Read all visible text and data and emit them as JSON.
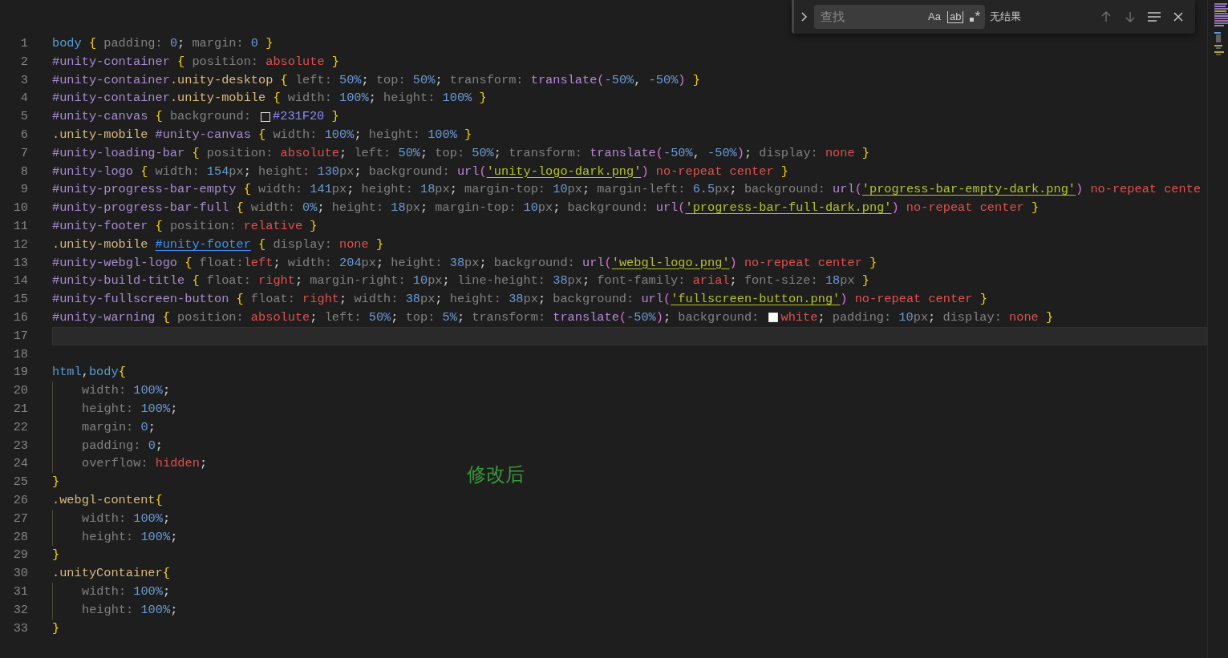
{
  "find_widget": {
    "placeholder": "查找",
    "options": [
      {
        "kind": "case",
        "label": "Aa"
      },
      {
        "kind": "word",
        "label": "ab"
      },
      {
        "kind": "regex",
        "label": "*"
      }
    ],
    "result": "无结果"
  },
  "lines": [
    {
      "number": "1",
      "tokens": [
        {
          "kind": "tag",
          "text": "body"
        },
        {
          "kind": "brace",
          "text": " {"
        },
        {
          "kind": "prop",
          "text": " padding: "
        },
        {
          "kind": "num",
          "text": "0"
        },
        {
          "kind": "p",
          "text": "; "
        },
        {
          "kind": "prop",
          "text": "margin: "
        },
        {
          "kind": "num",
          "text": "0"
        },
        {
          "kind": "brace",
          "text": " }"
        }
      ]
    },
    {
      "number": "2",
      "tokens": [
        {
          "kind": "id",
          "text": "#unity-container"
        },
        {
          "kind": "brace",
          "text": " {"
        },
        {
          "kind": "prop",
          "text": " position: "
        },
        {
          "kind": "val",
          "text": "absolute"
        },
        {
          "kind": "brace",
          "text": " }"
        }
      ]
    },
    {
      "number": "3",
      "tokens": [
        {
          "kind": "id",
          "text": "#unity-container"
        },
        {
          "kind": "cls",
          "text": ".unity-desktop"
        },
        {
          "kind": "brace",
          "text": " {"
        },
        {
          "kind": "prop",
          "text": " left: "
        },
        {
          "kind": "num",
          "text": "50%"
        },
        {
          "kind": "p",
          "text": "; "
        },
        {
          "kind": "prop",
          "text": "top: "
        },
        {
          "kind": "num",
          "text": "50%"
        },
        {
          "kind": "p",
          "text": "; "
        },
        {
          "kind": "prop",
          "text": "transform: "
        },
        {
          "kind": "fn",
          "text": "translate"
        },
        {
          "kind": "paren",
          "text": "("
        },
        {
          "kind": "num",
          "text": "-50%"
        },
        {
          "kind": "p",
          "text": ", "
        },
        {
          "kind": "num",
          "text": "-50%"
        },
        {
          "kind": "paren",
          "text": ")"
        },
        {
          "kind": "brace",
          "text": " }"
        }
      ]
    },
    {
      "number": "4",
      "tokens": [
        {
          "kind": "id",
          "text": "#unity-container"
        },
        {
          "kind": "cls",
          "text": ".unity-mobile"
        },
        {
          "kind": "brace",
          "text": " {"
        },
        {
          "kind": "prop",
          "text": " width: "
        },
        {
          "kind": "num",
          "text": "100%"
        },
        {
          "kind": "p",
          "text": "; "
        },
        {
          "kind": "prop",
          "text": "height: "
        },
        {
          "kind": "num",
          "text": "100%"
        },
        {
          "kind": "brace",
          "text": " }"
        }
      ]
    },
    {
      "number": "5",
      "tokens": [
        {
          "kind": "id",
          "text": "#unity-canvas"
        },
        {
          "kind": "brace",
          "text": " {"
        },
        {
          "kind": "prop",
          "text": " background: "
        },
        {
          "kind": "swatch",
          "color": "#231f20"
        },
        {
          "kind": "hex",
          "text": "#231F20"
        },
        {
          "kind": "brace",
          "text": " }"
        }
      ]
    },
    {
      "number": "6",
      "tokens": [
        {
          "kind": "cls",
          "text": ".unity-mobile "
        },
        {
          "kind": "id",
          "text": "#unity-canvas"
        },
        {
          "kind": "brace",
          "text": " {"
        },
        {
          "kind": "prop",
          "text": " width: "
        },
        {
          "kind": "num",
          "text": "100%"
        },
        {
          "kind": "p",
          "text": "; "
        },
        {
          "kind": "prop",
          "text": "height: "
        },
        {
          "kind": "num",
          "text": "100%"
        },
        {
          "kind": "brace",
          "text": " }"
        }
      ]
    },
    {
      "number": "7",
      "tokens": [
        {
          "kind": "id",
          "text": "#unity-loading-bar"
        },
        {
          "kind": "brace",
          "text": " {"
        },
        {
          "kind": "prop",
          "text": " position: "
        },
        {
          "kind": "val",
          "text": "absolute"
        },
        {
          "kind": "p",
          "text": "; "
        },
        {
          "kind": "prop",
          "text": "left: "
        },
        {
          "kind": "num",
          "text": "50%"
        },
        {
          "kind": "p",
          "text": "; "
        },
        {
          "kind": "prop",
          "text": "top: "
        },
        {
          "kind": "num",
          "text": "50%"
        },
        {
          "kind": "p",
          "text": "; "
        },
        {
          "kind": "prop",
          "text": "transform: "
        },
        {
          "kind": "fn",
          "text": "translate"
        },
        {
          "kind": "paren",
          "text": "("
        },
        {
          "kind": "num",
          "text": "-50%"
        },
        {
          "kind": "p",
          "text": ", "
        },
        {
          "kind": "num",
          "text": "-50%"
        },
        {
          "kind": "paren",
          "text": ")"
        },
        {
          "kind": "p",
          "text": "; "
        },
        {
          "kind": "prop",
          "text": "display: "
        },
        {
          "kind": "val",
          "text": "none"
        },
        {
          "kind": "brace",
          "text": " }"
        }
      ]
    },
    {
      "number": "8",
      "tokens": [
        {
          "kind": "id",
          "text": "#unity-logo"
        },
        {
          "kind": "brace",
          "text": " {"
        },
        {
          "kind": "prop",
          "text": " width: "
        },
        {
          "kind": "num",
          "text": "154"
        },
        {
          "kind": "unit",
          "text": "px"
        },
        {
          "kind": "p",
          "text": "; "
        },
        {
          "kind": "prop",
          "text": "height: "
        },
        {
          "kind": "num",
          "text": "130"
        },
        {
          "kind": "unit",
          "text": "px"
        },
        {
          "kind": "p",
          "text": "; "
        },
        {
          "kind": "prop",
          "text": "background: "
        },
        {
          "kind": "fn",
          "text": "url"
        },
        {
          "kind": "paren",
          "text": "("
        },
        {
          "kind": "str",
          "text": "'unity-logo-dark.png'"
        },
        {
          "kind": "paren",
          "text": ")"
        },
        {
          "kind": "val",
          "text": " no-repeat center"
        },
        {
          "kind": "brace",
          "text": " }"
        }
      ]
    },
    {
      "number": "9",
      "tokens": [
        {
          "kind": "id",
          "text": "#unity-progress-bar-empty"
        },
        {
          "kind": "brace",
          "text": " {"
        },
        {
          "kind": "prop",
          "text": " width: "
        },
        {
          "kind": "num",
          "text": "141"
        },
        {
          "kind": "unit",
          "text": "px"
        },
        {
          "kind": "p",
          "text": "; "
        },
        {
          "kind": "prop",
          "text": "height: "
        },
        {
          "kind": "num",
          "text": "18"
        },
        {
          "kind": "unit",
          "text": "px"
        },
        {
          "kind": "p",
          "text": "; "
        },
        {
          "kind": "prop",
          "text": "margin-top: "
        },
        {
          "kind": "num",
          "text": "10"
        },
        {
          "kind": "unit",
          "text": "px"
        },
        {
          "kind": "p",
          "text": "; "
        },
        {
          "kind": "prop",
          "text": "margin-left: "
        },
        {
          "kind": "num",
          "text": "6.5"
        },
        {
          "kind": "unit",
          "text": "px"
        },
        {
          "kind": "p",
          "text": "; "
        },
        {
          "kind": "prop",
          "text": "background: "
        },
        {
          "kind": "fn",
          "text": "url"
        },
        {
          "kind": "paren",
          "text": "("
        },
        {
          "kind": "str",
          "text": "'progress-bar-empty-dark.png'"
        },
        {
          "kind": "paren",
          "text": ")"
        },
        {
          "kind": "val",
          "text": " no-repeat cente"
        }
      ]
    },
    {
      "number": "10",
      "tokens": [
        {
          "kind": "id",
          "text": "#unity-progress-bar-full"
        },
        {
          "kind": "brace",
          "text": " {"
        },
        {
          "kind": "prop",
          "text": " width: "
        },
        {
          "kind": "num",
          "text": "0%"
        },
        {
          "kind": "p",
          "text": "; "
        },
        {
          "kind": "prop",
          "text": "height: "
        },
        {
          "kind": "num",
          "text": "18"
        },
        {
          "kind": "unit",
          "text": "px"
        },
        {
          "kind": "p",
          "text": "; "
        },
        {
          "kind": "prop",
          "text": "margin-top: "
        },
        {
          "kind": "num",
          "text": "10"
        },
        {
          "kind": "unit",
          "text": "px"
        },
        {
          "kind": "p",
          "text": "; "
        },
        {
          "kind": "prop",
          "text": "background: "
        },
        {
          "kind": "fn",
          "text": "url"
        },
        {
          "kind": "paren",
          "text": "("
        },
        {
          "kind": "str",
          "text": "'progress-bar-full-dark.png'"
        },
        {
          "kind": "paren",
          "text": ")"
        },
        {
          "kind": "val",
          "text": " no-repeat center"
        },
        {
          "kind": "brace",
          "text": " }"
        }
      ]
    },
    {
      "number": "11",
      "tokens": [
        {
          "kind": "id",
          "text": "#unity-footer"
        },
        {
          "kind": "brace",
          "text": " {"
        },
        {
          "kind": "prop",
          "text": " position: "
        },
        {
          "kind": "val",
          "text": "relative"
        },
        {
          "kind": "brace",
          "text": " }"
        }
      ]
    },
    {
      "number": "12",
      "tokens": [
        {
          "kind": "cls",
          "text": ".unity-mobile "
        },
        {
          "kind": "link",
          "text": "#unity-footer"
        },
        {
          "kind": "brace",
          "text": " {"
        },
        {
          "kind": "prop",
          "text": " display: "
        },
        {
          "kind": "val",
          "text": "none"
        },
        {
          "kind": "brace",
          "text": " }"
        }
      ]
    },
    {
      "number": "13",
      "tokens": [
        {
          "kind": "id",
          "text": "#unity-webgl-logo"
        },
        {
          "kind": "brace",
          "text": " {"
        },
        {
          "kind": "prop",
          "text": " float:"
        },
        {
          "kind": "val",
          "text": "left"
        },
        {
          "kind": "p",
          "text": "; "
        },
        {
          "kind": "prop",
          "text": "width: "
        },
        {
          "kind": "num",
          "text": "204"
        },
        {
          "kind": "unit",
          "text": "px"
        },
        {
          "kind": "p",
          "text": "; "
        },
        {
          "kind": "prop",
          "text": "height: "
        },
        {
          "kind": "num",
          "text": "38"
        },
        {
          "kind": "unit",
          "text": "px"
        },
        {
          "kind": "p",
          "text": "; "
        },
        {
          "kind": "prop",
          "text": "background: "
        },
        {
          "kind": "fn",
          "text": "url"
        },
        {
          "kind": "paren",
          "text": "("
        },
        {
          "kind": "str",
          "text": "'webgl-logo.png'"
        },
        {
          "kind": "paren",
          "text": ")"
        },
        {
          "kind": "val",
          "text": " no-repeat center"
        },
        {
          "kind": "brace",
          "text": " }"
        }
      ]
    },
    {
      "number": "14",
      "tokens": [
        {
          "kind": "id",
          "text": "#unity-build-title"
        },
        {
          "kind": "brace",
          "text": " {"
        },
        {
          "kind": "prop",
          "text": " float: "
        },
        {
          "kind": "val",
          "text": "right"
        },
        {
          "kind": "p",
          "text": "; "
        },
        {
          "kind": "prop",
          "text": "margin-right: "
        },
        {
          "kind": "num",
          "text": "10"
        },
        {
          "kind": "unit",
          "text": "px"
        },
        {
          "kind": "p",
          "text": "; "
        },
        {
          "kind": "prop",
          "text": "line-height: "
        },
        {
          "kind": "num",
          "text": "38"
        },
        {
          "kind": "unit",
          "text": "px"
        },
        {
          "kind": "p",
          "text": "; "
        },
        {
          "kind": "prop",
          "text": "font-family: "
        },
        {
          "kind": "val",
          "text": "arial"
        },
        {
          "kind": "p",
          "text": "; "
        },
        {
          "kind": "prop",
          "text": "font-size: "
        },
        {
          "kind": "num",
          "text": "18"
        },
        {
          "kind": "unit",
          "text": "px"
        },
        {
          "kind": "brace",
          "text": " }"
        }
      ]
    },
    {
      "number": "15",
      "tokens": [
        {
          "kind": "id",
          "text": "#unity-fullscreen-button"
        },
        {
          "kind": "brace",
          "text": " {"
        },
        {
          "kind": "prop",
          "text": " float: "
        },
        {
          "kind": "val",
          "text": "right"
        },
        {
          "kind": "p",
          "text": "; "
        },
        {
          "kind": "prop",
          "text": "width: "
        },
        {
          "kind": "num",
          "text": "38"
        },
        {
          "kind": "unit",
          "text": "px"
        },
        {
          "kind": "p",
          "text": "; "
        },
        {
          "kind": "prop",
          "text": "height: "
        },
        {
          "kind": "num",
          "text": "38"
        },
        {
          "kind": "unit",
          "text": "px"
        },
        {
          "kind": "p",
          "text": "; "
        },
        {
          "kind": "prop",
          "text": "background: "
        },
        {
          "kind": "fn",
          "text": "url"
        },
        {
          "kind": "paren",
          "text": "("
        },
        {
          "kind": "str",
          "text": "'fullscreen-button.png'"
        },
        {
          "kind": "paren",
          "text": ")"
        },
        {
          "kind": "val",
          "text": " no-repeat center"
        },
        {
          "kind": "brace",
          "text": " }"
        }
      ]
    },
    {
      "number": "16",
      "tokens": [
        {
          "kind": "id",
          "text": "#unity-warning"
        },
        {
          "kind": "brace",
          "text": " {"
        },
        {
          "kind": "prop",
          "text": " position: "
        },
        {
          "kind": "val",
          "text": "absolute"
        },
        {
          "kind": "p",
          "text": "; "
        },
        {
          "kind": "prop",
          "text": "left: "
        },
        {
          "kind": "num",
          "text": "50%"
        },
        {
          "kind": "p",
          "text": "; "
        },
        {
          "kind": "prop",
          "text": "top: "
        },
        {
          "kind": "num",
          "text": "5%"
        },
        {
          "kind": "p",
          "text": "; "
        },
        {
          "kind": "prop",
          "text": "transform: "
        },
        {
          "kind": "fn",
          "text": "translate"
        },
        {
          "kind": "paren",
          "text": "("
        },
        {
          "kind": "num",
          "text": "-50%"
        },
        {
          "kind": "paren",
          "text": ")"
        },
        {
          "kind": "p",
          "text": "; "
        },
        {
          "kind": "prop",
          "text": "background: "
        },
        {
          "kind": "swatch",
          "color": "#ffffff"
        },
        {
          "kind": "val",
          "text": "white"
        },
        {
          "kind": "p",
          "text": "; "
        },
        {
          "kind": "prop",
          "text": "padding: "
        },
        {
          "kind": "num",
          "text": "10"
        },
        {
          "kind": "unit",
          "text": "px"
        },
        {
          "kind": "p",
          "text": "; "
        },
        {
          "kind": "prop",
          "text": "display: "
        },
        {
          "kind": "val",
          "text": "none"
        },
        {
          "kind": "brace",
          "text": " }"
        }
      ]
    },
    {
      "number": "17",
      "current": true
    },
    {
      "number": "18"
    },
    {
      "number": "19",
      "tokens": [
        {
          "kind": "tag",
          "text": "html"
        },
        {
          "kind": "p",
          "text": ","
        },
        {
          "kind": "tag",
          "text": "body"
        },
        {
          "kind": "brace",
          "text": "{"
        }
      ]
    },
    {
      "number": "20",
      "indent": true,
      "tokens": [
        {
          "kind": "prop",
          "text": "width: "
        },
        {
          "kind": "num",
          "text": "100%"
        },
        {
          "kind": "p",
          "text": ";"
        }
      ]
    },
    {
      "number": "21",
      "indent": true,
      "tokens": [
        {
          "kind": "prop",
          "text": "height: "
        },
        {
          "kind": "num",
          "text": "100%"
        },
        {
          "kind": "p",
          "text": ";"
        }
      ]
    },
    {
      "number": "22",
      "indent": true,
      "tokens": [
        {
          "kind": "prop",
          "text": "margin: "
        },
        {
          "kind": "num",
          "text": "0"
        },
        {
          "kind": "p",
          "text": ";"
        }
      ]
    },
    {
      "number": "23",
      "indent": true,
      "tokens": [
        {
          "kind": "prop",
          "text": "padding: "
        },
        {
          "kind": "num",
          "text": "0"
        },
        {
          "kind": "p",
          "text": ";"
        }
      ]
    },
    {
      "number": "24",
      "indent": true,
      "tokens": [
        {
          "kind": "prop",
          "text": "overflow: "
        },
        {
          "kind": "val",
          "text": "hidden"
        },
        {
          "kind": "p",
          "text": ";"
        }
      ]
    },
    {
      "number": "25",
      "tokens": [
        {
          "kind": "brace",
          "text": "}"
        }
      ]
    },
    {
      "number": "26",
      "tokens": [
        {
          "kind": "cls",
          "text": ".webgl-content"
        },
        {
          "kind": "brace",
          "text": "{"
        }
      ]
    },
    {
      "number": "27",
      "indent": true,
      "tokens": [
        {
          "kind": "prop",
          "text": "width: "
        },
        {
          "kind": "num",
          "text": "100%"
        },
        {
          "kind": "p",
          "text": ";"
        }
      ]
    },
    {
      "number": "28",
      "indent": true,
      "tokens": [
        {
          "kind": "prop",
          "text": "height: "
        },
        {
          "kind": "num",
          "text": "100%"
        },
        {
          "kind": "p",
          "text": ";"
        }
      ]
    },
    {
      "number": "29",
      "tokens": [
        {
          "kind": "brace",
          "text": "}"
        }
      ]
    },
    {
      "number": "30",
      "tokens": [
        {
          "kind": "cls",
          "text": ".unityContainer"
        },
        {
          "kind": "brace",
          "text": "{"
        }
      ]
    },
    {
      "number": "31",
      "indent": true,
      "tokens": [
        {
          "kind": "prop",
          "text": "width: "
        },
        {
          "kind": "num",
          "text": "100%"
        },
        {
          "kind": "p",
          "text": ";"
        }
      ]
    },
    {
      "number": "32",
      "indent": true,
      "tokens": [
        {
          "kind": "prop",
          "text": "height: "
        },
        {
          "kind": "num",
          "text": "100%"
        },
        {
          "kind": "p",
          "text": ";"
        }
      ]
    },
    {
      "number": "33",
      "tokens": [
        {
          "kind": "brace",
          "text": "}"
        }
      ]
    }
  ],
  "annotation": "修改后"
}
